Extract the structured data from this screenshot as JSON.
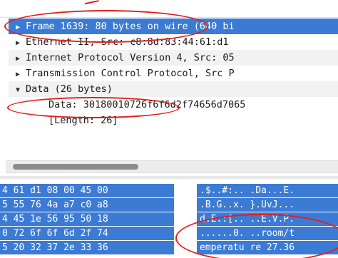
{
  "details": {
    "rows": [
      {
        "label": "Frame 1639: 80 bytes on wire (640 bi",
        "arrow": "▶"
      },
      {
        "label": "Ethernet II, Src: c8:8d:83:44:61:d1",
        "arrow": "▶"
      },
      {
        "label": "Internet Protocol Version 4, Src: 05",
        "arrow": "▶"
      },
      {
        "label": "Transmission Control Protocol, Src P",
        "arrow": "▶"
      },
      {
        "label": "Data (26 bytes)",
        "arrow": "▼"
      }
    ],
    "children": [
      {
        "label": "Data: 30180010726f6f6d2f74656d7065"
      },
      {
        "label": "[Length: 26]"
      }
    ]
  },
  "hex": {
    "lines": [
      "4 61 d1 08 00 45 00",
      "5 55 76 4a a7 c0 a8",
      "4 45 1e 56 95 50 18",
      "0 72 6f 6f 6d 2f 74",
      "5 20 32 37 2e 33 36"
    ]
  },
  "ascii": {
    "lines": [
      ".$..#:.. .Da...E.",
      ".B.G..x. }.UvJ...",
      "d.E.:[.. ..E.V.P.",
      "......0. ..room/t",
      "emperatu re 27.36"
    ]
  },
  "colors": {
    "selection": "#3b7bd4",
    "annotation": "#e0201b"
  }
}
